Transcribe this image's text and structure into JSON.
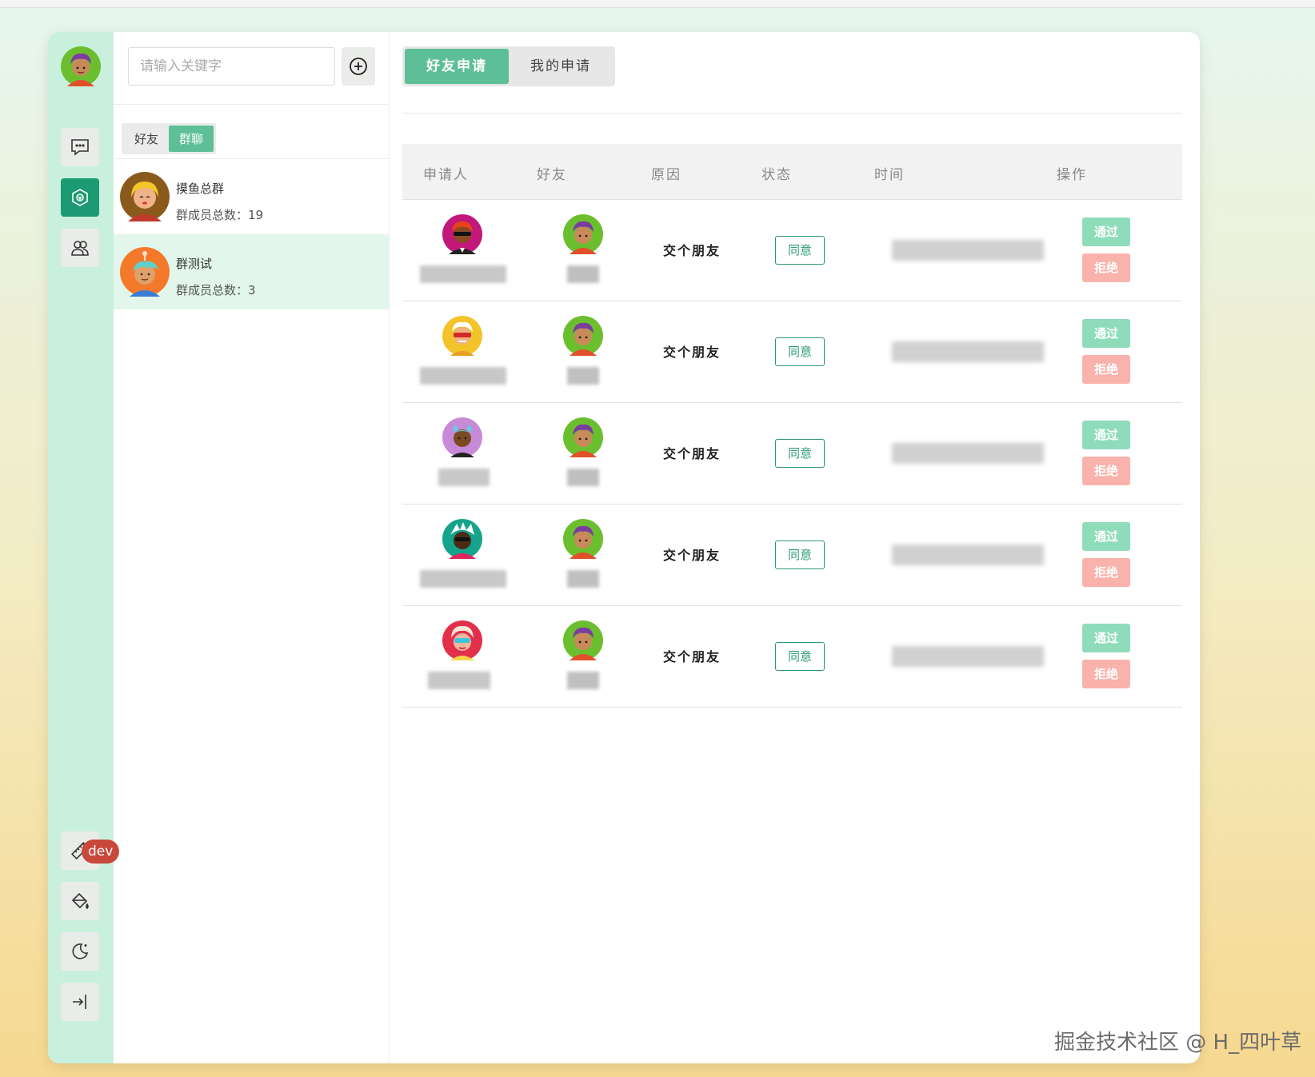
{
  "sidebar": {
    "dev_badge": "dev",
    "items": [
      {
        "icon": "chat-icon",
        "active": false
      },
      {
        "icon": "group-icon",
        "active": true
      },
      {
        "icon": "contacts-icon",
        "active": false
      }
    ],
    "bottom_items": [
      {
        "icon": "ruler-icon"
      },
      {
        "icon": "paint-bucket-icon"
      },
      {
        "icon": "moon-icon"
      },
      {
        "icon": "logout-icon"
      }
    ]
  },
  "list": {
    "search_placeholder": "请输入关键字",
    "segment": {
      "friends": "好友",
      "groups": "群聊",
      "active": "groups"
    },
    "groups": [
      {
        "name": "摸鱼总群",
        "member_label": "群成员总数：",
        "count": "19",
        "selected": false
      },
      {
        "name": "群测试",
        "member_label": "群成员总数：",
        "count": "3",
        "selected": true
      }
    ]
  },
  "main": {
    "tabs": [
      {
        "label": "好友申请",
        "active": true
      },
      {
        "label": "我的申请",
        "active": false
      }
    ],
    "columns": [
      "申请人",
      "好友",
      "原因",
      "状态",
      "时间",
      "操作"
    ],
    "rows": [
      {
        "reason": "交个朋友",
        "status": "同意",
        "pass": "通过",
        "reject": "拒绝"
      },
      {
        "reason": "交个朋友",
        "status": "同意",
        "pass": "通过",
        "reject": "拒绝"
      },
      {
        "reason": "交个朋友",
        "status": "同意",
        "pass": "通过",
        "reject": "拒绝"
      },
      {
        "reason": "交个朋友",
        "status": "同意",
        "pass": "通过",
        "reject": "拒绝"
      },
      {
        "reason": "交个朋友",
        "status": "同意",
        "pass": "通过",
        "reject": "拒绝"
      }
    ]
  },
  "watermark": "掘金技术社区 @ H_四叶草",
  "colors": {
    "accent": "#1c9a72",
    "accent_light": "#5dbf97",
    "pass": "#8fdcbb",
    "reject": "#f9b2ac",
    "rail": "#c9f0dc"
  }
}
